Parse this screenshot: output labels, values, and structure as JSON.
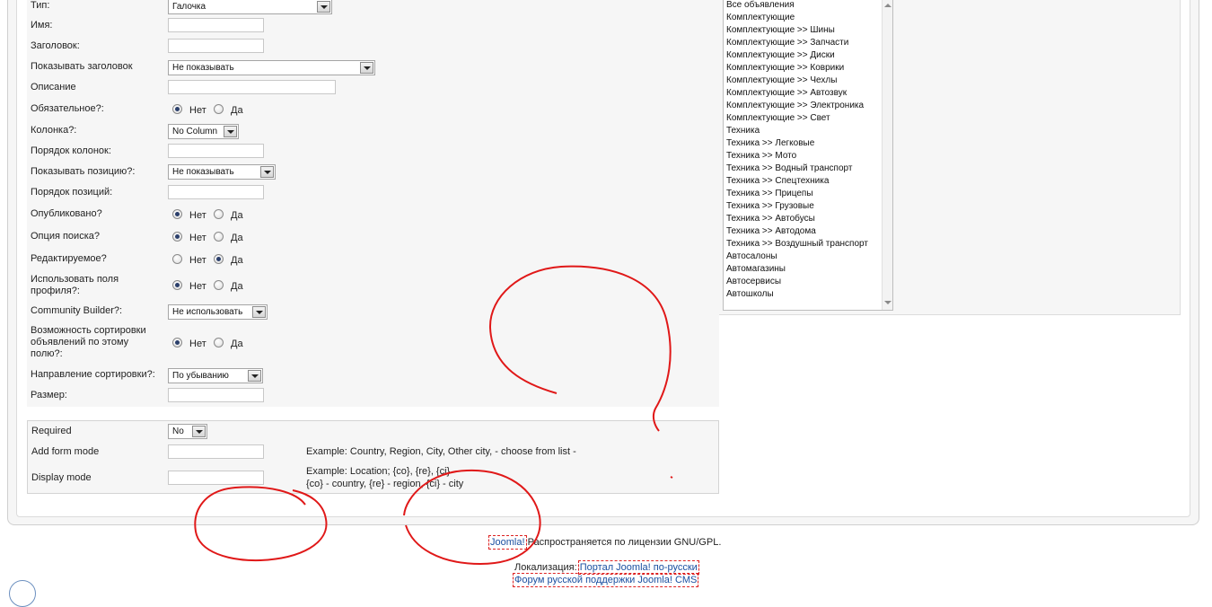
{
  "form": {
    "rows": [
      {
        "label": "Тип:",
        "kind": "select",
        "value": "Галочка"
      },
      {
        "label": "Имя:",
        "kind": "text",
        "value": ""
      },
      {
        "label": "Заголовок:",
        "kind": "text",
        "value": ""
      },
      {
        "label": "Показывать заголовок",
        "kind": "select",
        "value": "Не показывать"
      },
      {
        "label": "Описание",
        "kind": "text",
        "value": ""
      },
      {
        "label": "Обязательное?:",
        "kind": "radio",
        "selected": "Нет"
      },
      {
        "label": "Колонка?:",
        "kind": "select",
        "value": "No Column"
      },
      {
        "label": "Порядок колонок:",
        "kind": "text",
        "value": ""
      },
      {
        "label": "Показывать позицию?:",
        "kind": "select",
        "value": "Не показывать"
      },
      {
        "label": "Порядок позиций:",
        "kind": "text",
        "value": ""
      },
      {
        "label": "Опубликовано?",
        "kind": "radio",
        "selected": "Нет"
      },
      {
        "label": "Опция поиска?",
        "kind": "radio",
        "selected": "Нет"
      },
      {
        "label": "Редактируемое?",
        "kind": "radio",
        "selected": "Да"
      },
      {
        "label": "Использовать поля профиля?:",
        "kind": "radio",
        "selected": "Нет"
      },
      {
        "label": "Community Builder?:",
        "kind": "select",
        "value": "Не использовать"
      },
      {
        "label": "Возможность сортировки объявлений по этому полю?:",
        "kind": "radio",
        "selected": "Нет"
      },
      {
        "label": "Направление сортировки?:",
        "kind": "select",
        "value": "По убыванию"
      },
      {
        "label": "Размер:",
        "kind": "text",
        "value": ""
      }
    ],
    "radio_no": "Нет",
    "radio_yes": "Да"
  },
  "categories": [
    "Все объявления",
    "Комплектующие",
    "Комплектующие >> Шины",
    "Комплектующие >> Запчасти",
    "Комплектующие >> Диски",
    "Комплектующие >> Коврики",
    "Комплектующие >> Чехлы",
    "Комплектующие >> Автозвук",
    "Комплектующие >> Электроника",
    "Комплектующие >> Свет",
    "Техника",
    "Техника >> Легковые",
    "Техника >> Мото",
    "Техника >> Водный транспорт",
    "Техника >> Спецтехника",
    "Техника >> Прицепы",
    "Техника >> Грузовые",
    "Техника >> Автобусы",
    "Техника >> Автодома",
    "Техника >> Воздушный транспорт",
    "Автосалоны",
    "Автомагазины",
    "Автосервисы",
    "Автошколы"
  ],
  "extra": {
    "required_label": "Required",
    "required_value": "No",
    "add_form_label": "Add form mode",
    "add_form_value": "",
    "add_form_hint": "Example: Country, Region, City, Other city, - choose from list -",
    "display_label": "Display mode",
    "display_value": "",
    "display_hint_1": "Example: Location; {co}, {re}, {ci}",
    "display_hint_2": "{co} - country, {re} - region, {ci} - city"
  },
  "footer": {
    "joomla_link": "Joomla!",
    "license_text": "Распространяется по лицензии GNU/GPL.",
    "localization_label": "Локализация:",
    "portal_link": "Портал Joomla! по-русски",
    "forum_link": "Форум русской поддержки Joomla! CMS"
  },
  "colors": {
    "annotation": "#e01818",
    "link": "#1a4fa0",
    "panel": "#f6f6f6"
  }
}
